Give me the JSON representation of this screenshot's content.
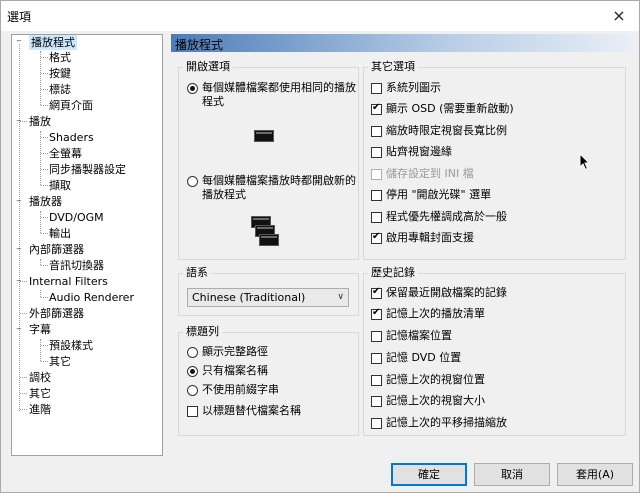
{
  "window": {
    "title": "選項",
    "close_glyph": "×"
  },
  "tree": {
    "items": [
      {
        "label": "播放程式"
      },
      {
        "label": "格式"
      },
      {
        "label": "按鍵"
      },
      {
        "label": "標誌"
      },
      {
        "label": "網頁介面"
      },
      {
        "label": "播放"
      },
      {
        "label": "Shaders"
      },
      {
        "label": "全螢幕"
      },
      {
        "label": "同步播製器設定"
      },
      {
        "label": "擷取"
      },
      {
        "label": "播放器"
      },
      {
        "label": "DVD/OGM"
      },
      {
        "label": "輸出"
      },
      {
        "label": "內部篩選器"
      },
      {
        "label": "音訊切換器"
      },
      {
        "label": "Internal Filters"
      },
      {
        "label": "Audio Renderer"
      },
      {
        "label": "外部篩選器"
      },
      {
        "label": "字幕"
      },
      {
        "label": "預設樣式"
      },
      {
        "label": "其它"
      },
      {
        "label": "調校"
      },
      {
        "label": "其它"
      },
      {
        "label": "進階"
      }
    ],
    "toggle_glyph": "−"
  },
  "panel": {
    "title": "播放程式"
  },
  "open_options": {
    "label": "開啟選項",
    "opt1": "每個媒體檔案都使用相同的播放程式",
    "opt1_line1": "每個媒體檔案都使用相同的播放",
    "opt1_line2": "程式",
    "opt2_line1": "每個媒體檔案播放時都開啟新的",
    "opt2_line2": "播放程式",
    "selected": "opt1"
  },
  "language": {
    "label": "語系",
    "value": "Chinese (Traditional)",
    "arrow": "∨"
  },
  "titlebar_group": {
    "label": "標題列",
    "options": [
      "顯示完整路徑",
      "只有檔案名稱",
      "不使用前綴字串"
    ],
    "selected_index": 1,
    "checkbox": "以標題替代檔案名稱",
    "checkbox_checked": false
  },
  "other_options": {
    "label": "其它選項",
    "items": [
      {
        "label": "系統列圖示",
        "checked": false
      },
      {
        "label": "顯示 OSD (需要重新啟動)",
        "checked": true
      },
      {
        "label": "縮放時限定視窗長寬比例",
        "checked": false
      },
      {
        "label": "貼齊視窗邊緣",
        "checked": false
      },
      {
        "label": "儲存設定到 INI 檔",
        "checked": false,
        "disabled": true
      },
      {
        "label": "停用 \"開啟光碟\" 選單",
        "checked": false
      },
      {
        "label": "程式優先權調成高於一般",
        "checked": false
      },
      {
        "label": "啟用專輯封面支援",
        "checked": true
      }
    ]
  },
  "history": {
    "label": "歷史記錄",
    "items": [
      {
        "label": "保留最近開啟檔案的記錄",
        "checked": true
      },
      {
        "label": "記憶上次的播放清單",
        "checked": true
      },
      {
        "label": "記憶檔案位置",
        "checked": false
      },
      {
        "label": "記憶 DVD 位置",
        "checked": false
      },
      {
        "label": "記憶上次的視窗位置",
        "checked": false
      },
      {
        "label": "記憶上次的視窗大小",
        "checked": false
      },
      {
        "label": "記憶上次的平移掃描縮放",
        "checked": false
      }
    ]
  },
  "buttons": {
    "ok": "確定",
    "cancel": "取消",
    "apply": "套用(A)"
  }
}
